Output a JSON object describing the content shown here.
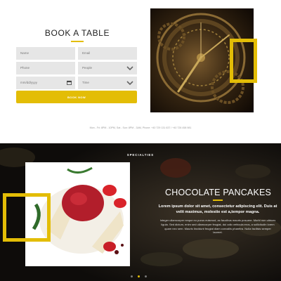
{
  "booking": {
    "title": "BOOK A TABLE",
    "fields": {
      "name_placeholder": "Name",
      "email_placeholder": "Email",
      "phone_placeholder": "Phone",
      "people_placeholder": "People",
      "date_placeholder": "mm/dd/yyyy",
      "time_placeholder": "Time"
    },
    "submit_label": "BOOK NOW",
    "hours_text": "Mon - Fri: 8PM - 10PM, Sat - Sun: 8PM - 3AM, Phone: +40 729 131 637 / +40 726 458 981"
  },
  "specialties": {
    "section_label": "SPECIALTIES",
    "dish_title": "CHOCOLATE PANCAKES",
    "dish_lead": "Lorem ipsum dolor sit amet, consectetur adipiscing elit. Duis at velit maximus, molestie est a,tempor magna.",
    "dish_body": "Integer ullamcorper neque eu purus euismod, ac faucibus mauris posuere. Morbi non ultrices ligula. Sed dictum, enim sed ullamcorper feugiat, dui odio vehicula eros, a sollicitudin lorem quam nec sem. Mauris tincidunt feugiat diam convallis pharetra. Nulla facilisis semper laoreet.",
    "slides": 3,
    "active_slide": 2
  },
  "colors": {
    "accent": "#e3bd06",
    "dark_background": "#141210",
    "field_background": "#e6e6e6"
  },
  "icons": [
    "chevron-down-icon",
    "calendar-icon"
  ]
}
